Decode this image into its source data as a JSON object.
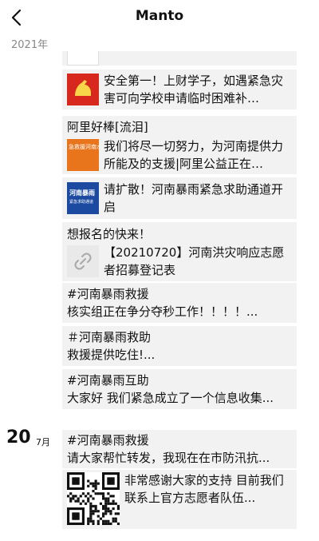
{
  "nav": {
    "title": "Manto"
  },
  "timeline": {
    "year": "2021年"
  },
  "day_header": {
    "day": "20",
    "month": "7月"
  },
  "posts": {
    "p1": {
      "text": "安全第一！上财学子，如遇紧急灾害可向学校申请临时困难补…"
    },
    "p2": {
      "caption": "阿里好棒[流泪]",
      "thumb_text": "急救援河南水",
      "text": "我们将尽一切努力，为河南提供力所能及的支援|阿里公益正在…"
    },
    "p3": {
      "thumb_text_1": "河南暴雨",
      "thumb_text_2": "紧急求助通道",
      "text": "请扩散！河南暴雨紧急求助通道开启"
    },
    "p4": {
      "caption": "想报名的快来！",
      "text": "【20210720】河南洪灾响应志愿者招募登记表"
    },
    "p5": {
      "line1": "#河南暴雨救援",
      "line2": "核实组正在争分夺秒工作！！！！..."
    },
    "p6": {
      "line1": "＃河南暴雨救助",
      "line2": "救援提供吃住!..."
    },
    "p7": {
      "line1": "#河南暴雨互助",
      "line2": "大家好 我们紧急成立了一个信息收集..."
    },
    "p8": {
      "line1": "#河南暴雨救援",
      "line2": "请大家帮忙转发，我现在在市防汛抗...",
      "shared_text": "非常感谢大家的支持 目前我们联系上官方志愿者队伍..."
    }
  }
}
